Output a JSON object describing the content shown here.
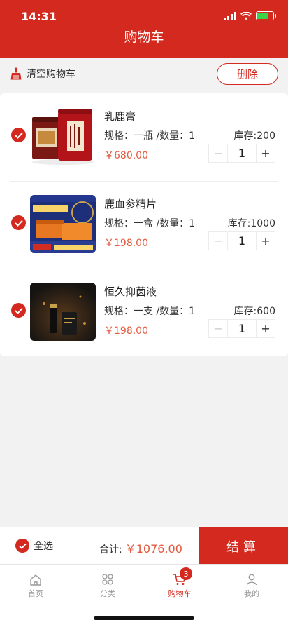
{
  "status": {
    "time": "14:31"
  },
  "header": {
    "title": "购物车"
  },
  "toolbar": {
    "clear_label": "清空购物车",
    "delete_label": "删除"
  },
  "cart": {
    "items": [
      {
        "name": "乳鹿膏",
        "spec": "规格：一瓶 /数量：1",
        "stock": "库存:200",
        "price": "￥680.00",
        "qty": "1"
      },
      {
        "name": "鹿血参精片",
        "spec": "规格：一盒 /数量：1",
        "stock": "库存:1000",
        "price": "￥198.00",
        "qty": "1"
      },
      {
        "name": "恒久抑菌液",
        "spec": "规格：一支 /数量：1",
        "stock": "库存:600",
        "price": "￥198.00",
        "qty": "1"
      }
    ]
  },
  "checkout": {
    "select_all_label": "全选",
    "total_label": "合计:",
    "total_amount": "￥1076.00",
    "button_label": "结算"
  },
  "tabbar": {
    "items": [
      {
        "label": "首页",
        "icon": "home-icon"
      },
      {
        "label": "分类",
        "icon": "category-icon"
      },
      {
        "label": "购物车",
        "icon": "cart-icon",
        "badge": "3",
        "active": true
      },
      {
        "label": "我的",
        "icon": "profile-icon"
      }
    ]
  },
  "colors": {
    "brand": "#d4291f",
    "price": "#e25a3f"
  }
}
